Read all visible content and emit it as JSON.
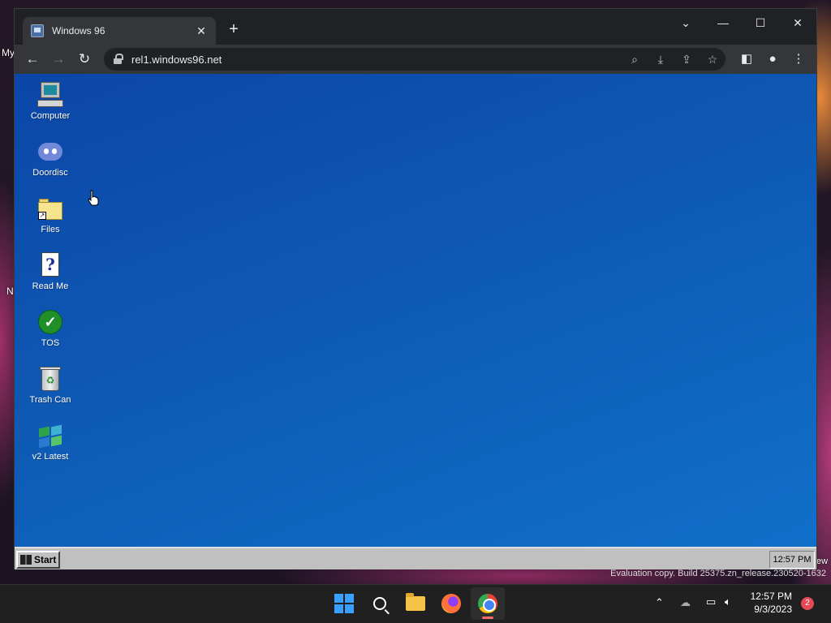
{
  "browser": {
    "tab_title": "Windows 96",
    "url": "rel1.windows96.net",
    "new_tab_label": "+",
    "tab_close_label": "✕"
  },
  "host": {
    "desktop_fragments": [
      "My",
      "N"
    ],
    "eval_text": "Evaluation copy. Build 25375.zn_release.230520-1632",
    "right_edge_fragment": "ew",
    "clock_time": "12:57 PM",
    "clock_date": "9/3/2023",
    "notification_count": "2"
  },
  "w96": {
    "desktop_icons": [
      {
        "label": "Computer",
        "icon": "computer-icon"
      },
      {
        "label": "Doordisc",
        "icon": "discord-icon"
      },
      {
        "label": "Files",
        "icon": "folder-shortcut-icon"
      },
      {
        "label": "Read Me",
        "icon": "readme-icon"
      },
      {
        "label": "TOS",
        "icon": "checkmark-icon"
      },
      {
        "label": "Trash Can",
        "icon": "recycle-bin-icon"
      },
      {
        "label": "v2 Latest",
        "icon": "windows-flag-icon"
      }
    ],
    "start_label": "Start",
    "tray_time": "12:57 PM"
  },
  "colors": {
    "desktop_top": "#0b46a8",
    "desktop_bottom": "#1070c9",
    "taskbar_gray": "#c0c0c0",
    "chrome_dark": "#202124"
  }
}
